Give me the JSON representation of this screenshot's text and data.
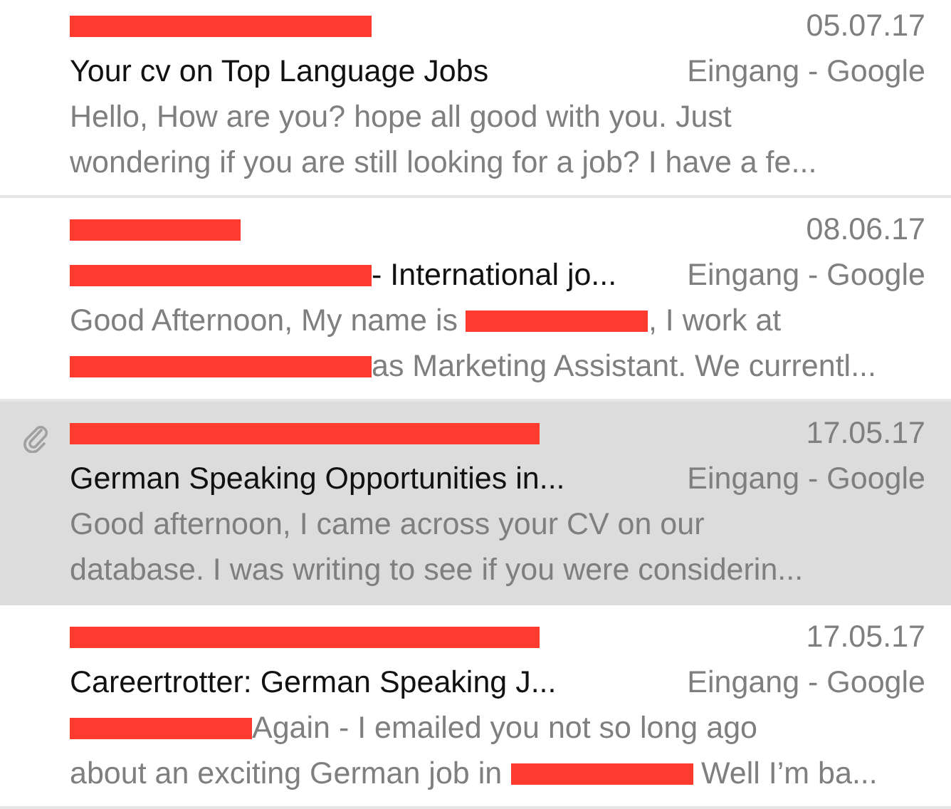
{
  "messages": [
    {
      "sender": [
        {
          "kind": "longbar"
        }
      ],
      "date": "05.07.17",
      "attachment": false,
      "selected": false,
      "subject": [
        {
          "kind": "text",
          "text": "Your cv on Top Language Jobs"
        }
      ],
      "mailbox": "Eingang - Google",
      "preview": [
        [
          {
            "kind": "text",
            "text": "Hello, How are you? hope all good with you. Just"
          }
        ],
        [
          {
            "kind": "text",
            "text": "wondering if you are still looking for a job? I have a fe..."
          }
        ]
      ]
    },
    {
      "sender": [
        {
          "kind": "shortbar"
        }
      ],
      "date": "08.06.17",
      "attachment": false,
      "selected": false,
      "subject": [
        {
          "kind": "longbar"
        },
        {
          "kind": "text",
          "text": "- International jo..."
        }
      ],
      "mailbox": "Eingang - Google",
      "preview": [
        [
          {
            "kind": "text",
            "text": "Good Afternoon, My name is "
          },
          {
            "kind": "bar"
          },
          {
            "kind": "text",
            "text": ", I work at"
          }
        ],
        [
          {
            "kind": "longbar"
          },
          {
            "kind": "text",
            "text": "as Marketing Assistant. We currentl..."
          }
        ]
      ]
    },
    {
      "sender": [
        {
          "kind": "widebar"
        }
      ],
      "date": "17.05.17",
      "attachment": true,
      "selected": true,
      "subject": [
        {
          "kind": "text",
          "text": "German Speaking Opportunities in..."
        }
      ],
      "mailbox": "Eingang - Google",
      "preview": [
        [
          {
            "kind": "text",
            "text": "Good afternoon, I came across your CV on our"
          }
        ],
        [
          {
            "kind": "text",
            "text": "database. I was writing to see if you were considerin..."
          }
        ]
      ]
    },
    {
      "sender": [
        {
          "kind": "widebar"
        }
      ],
      "date": "17.05.17",
      "attachment": false,
      "selected": false,
      "subject": [
        {
          "kind": "text",
          "text": "Careertrotter: German Speaking J..."
        }
      ],
      "mailbox": "Eingang - Google",
      "preview": [
        [
          {
            "kind": "bar"
          },
          {
            "kind": "text",
            "text": "Again - I emailed you not so long ago"
          }
        ],
        [
          {
            "kind": "text",
            "text": "about an exciting German job in "
          },
          {
            "kind": "bar"
          },
          {
            "kind": "text",
            "text": " Well I’m ba..."
          }
        ]
      ]
    }
  ]
}
